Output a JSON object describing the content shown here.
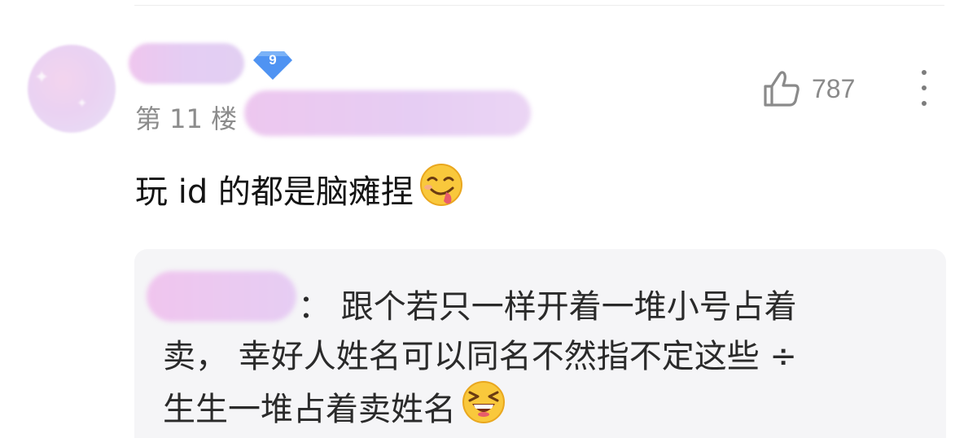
{
  "post": {
    "level": "9",
    "floor": "第 11 楼",
    "likes": "787",
    "comment_text": "玩 id 的都是脑瘫捏",
    "comment_emoji": "yum-face-icon",
    "reply": {
      "separator_and_line1": "： 跟个若只一样开着一堆小号占着",
      "line2": "卖， 幸好人姓名可以同名不然指不定这些 ÷",
      "line3": "生生一堆占着卖姓名",
      "emoji": "laughing-squint-face-icon"
    }
  },
  "colors": {
    "badge": "#4a90f0",
    "meta_text": "#8c8c8c",
    "reply_bg": "#f5f5f7"
  }
}
